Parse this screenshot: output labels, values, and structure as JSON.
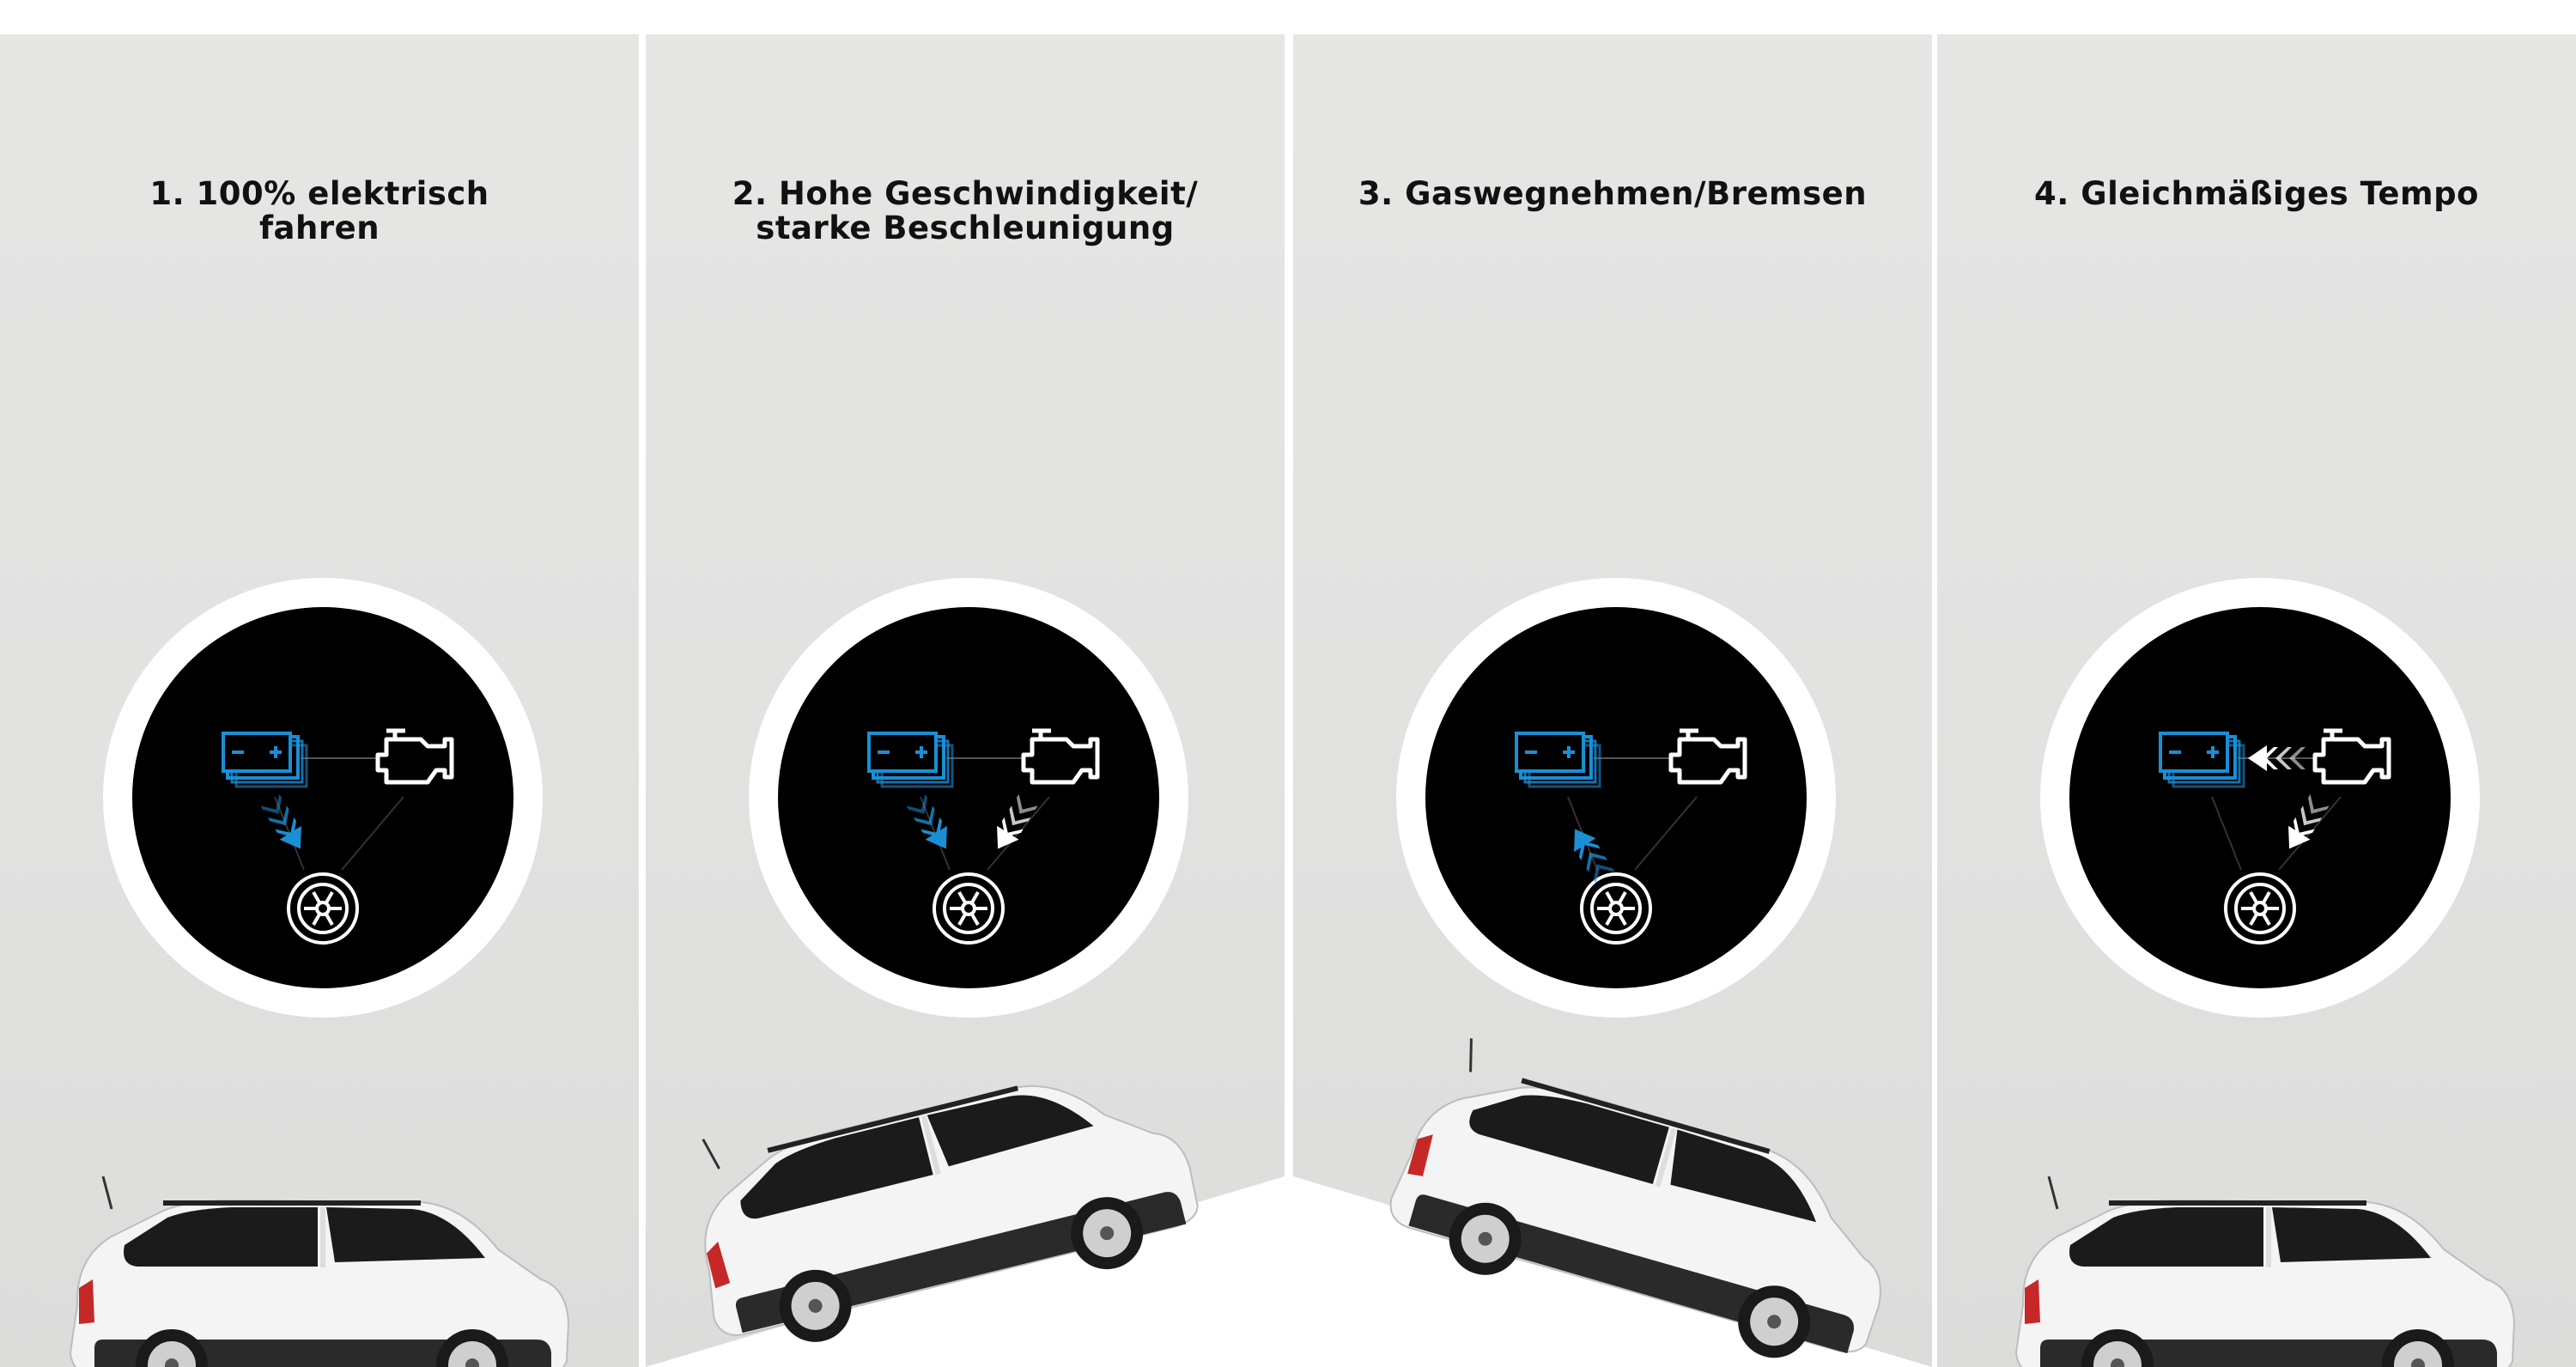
{
  "panels": [
    {
      "title_lines": [
        "1. 100% elektrisch",
        "fahren"
      ],
      "flows": [
        "battery-to-wheel"
      ],
      "terrain": "flat"
    },
    {
      "title_lines": [
        "2. Hohe Geschwindigkeit/",
        "starke Beschleunigung"
      ],
      "flows": [
        "battery-to-wheel",
        "engine-to-wheel"
      ],
      "terrain": "uphill"
    },
    {
      "title_lines": [
        "3. Gaswegnehmen/Bremsen"
      ],
      "flows": [
        "wheel-to-battery"
      ],
      "terrain": "downhill"
    },
    {
      "title_lines": [
        "4. Gleichmäßiges Tempo"
      ],
      "flows": [
        "engine-to-battery",
        "engine-to-wheel"
      ],
      "terrain": "flat"
    }
  ],
  "colors": {
    "electric": "#1a8fd6",
    "engine": "#ffffff",
    "disc": "#000000",
    "ring": "#ffffff",
    "background": "#e3e3e2",
    "title": "#111111"
  },
  "icons": [
    "battery-icon",
    "engine-icon",
    "wheel-icon",
    "car-image"
  ]
}
